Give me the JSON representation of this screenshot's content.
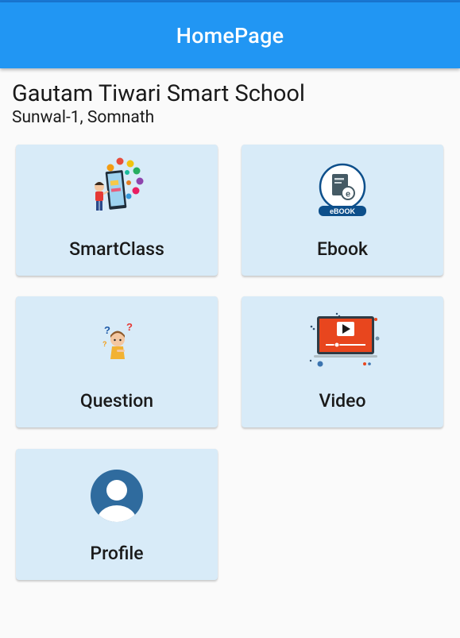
{
  "app_bar": {
    "title": "HomePage"
  },
  "school": {
    "name": "Gautam Tiwari Smart School",
    "address": "Sunwal-1, Somnath"
  },
  "cards": [
    {
      "label": "SmartClass",
      "icon": "smartclass-icon"
    },
    {
      "label": "Ebook",
      "icon": "ebook-icon",
      "badge": "eBOOK"
    },
    {
      "label": "Question",
      "icon": "question-icon"
    },
    {
      "label": "Video",
      "icon": "video-icon"
    },
    {
      "label": "Profile",
      "icon": "profile-icon"
    }
  ],
  "colors": {
    "app_bar": "#2196f3",
    "card_bg": "#d8ebf8",
    "ebook_blue": "#0d4f8b",
    "video_red": "#e8461e",
    "profile_blue": "#2f6b9e"
  }
}
